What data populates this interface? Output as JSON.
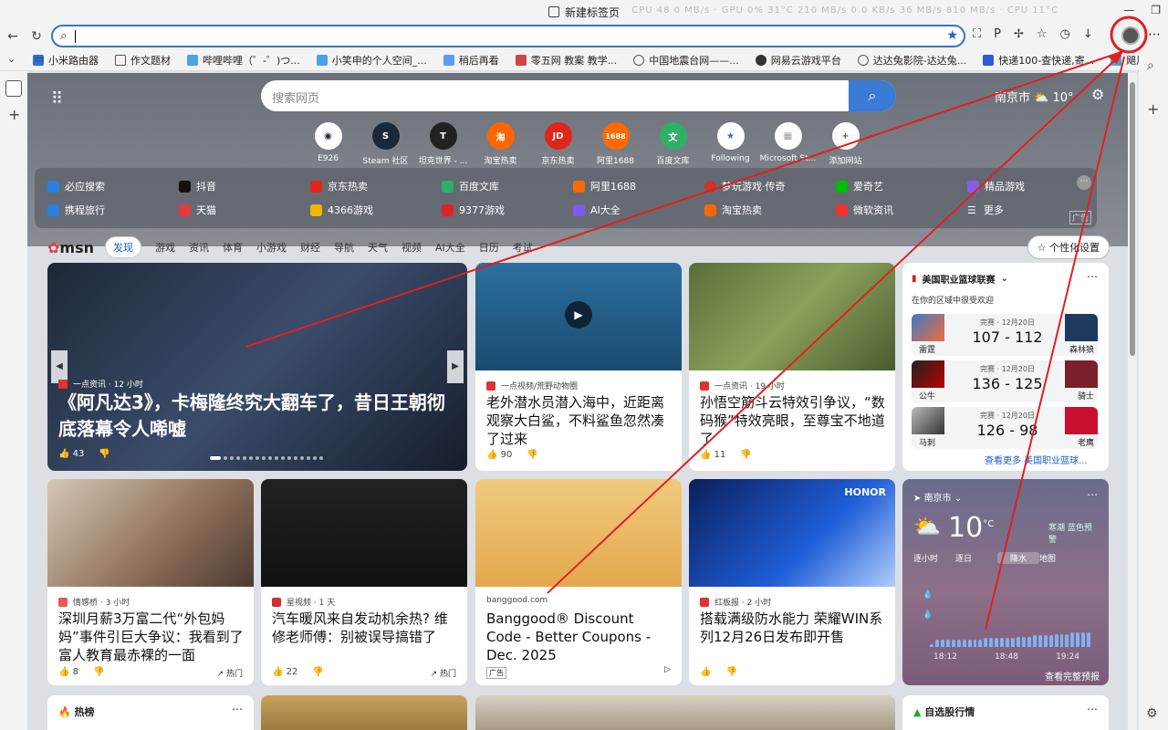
{
  "window": {
    "title": "新建标签页",
    "perf": "CPU 48 0 MB/s · GPU 0% 31°C 210 MB/s 0.0 KB/s 36 MB/s 810 MB/s · CPU 11°C"
  },
  "addressbar": {
    "value": ""
  },
  "bookmarks": [
    "小米路由器",
    "作文题材",
    "哔哩哔哩（゜-゜)つ...",
    "小笑申的个人空间_...",
    "稍后再看",
    "零五网 教案 教学...",
    "中国地震台网——...",
    "网易云游戏平台",
    "达达兔影院-达达兔...",
    "快递100-查快递,寄...",
    "飓风战魂_搜狗..."
  ],
  "ntp": {
    "search_placeholder": "搜索网页",
    "weather_city": "南京市",
    "weather_temp": "10°",
    "quick_links": [
      "E926",
      "Steam 社区",
      "坦克世界 - ...",
      "淘宝热卖",
      "京东热卖",
      "阿里1688",
      "百度文库",
      "Following",
      "Microsoft St...",
      "添加网站"
    ],
    "links_row1": [
      "必应搜索",
      "抖音",
      "京东热卖",
      "百度文库",
      "阿里1688",
      "梦玩游戏·传奇",
      "爱奇艺",
      "精品游戏"
    ],
    "links_row2": [
      "携程旅行",
      "天猫",
      "4366游戏",
      "9377游戏",
      "AI大全",
      "淘宝热卖",
      "微软资讯",
      "更多"
    ],
    "ad_label": "广告"
  },
  "msn": {
    "logo": "msn",
    "nav": [
      "发现",
      "游戏",
      "资讯",
      "体育",
      "小游戏",
      "财经",
      "导航",
      "天气",
      "视频",
      "AI大全",
      "日历",
      "考试"
    ],
    "personalize": "个性化设置"
  },
  "cards": {
    "hero": {
      "source": "一点资讯 · 12 小时",
      "title": "《阿凡达3》，卡梅隆终究大翻车了，昔日王朝彻底落幕令人唏嘘",
      "likes": "43"
    },
    "shark": {
      "source": "一点视频/荒野动物圈",
      "title": "老外潜水员潜入海中，近距离观察大白鲨，不料鲨鱼忽然凑了过来",
      "likes": "90"
    },
    "game": {
      "source": "一点资讯 · 19 小时",
      "title": "孙悟空筋斗云特效引争议，“数码猴”特效亮眼，至尊宝不地道了",
      "likes": "11"
    },
    "mom": {
      "source": "情感桥 · 3 小时",
      "title": "深圳月薪3万富二代“外包妈妈”事件引巨大争议：我看到了富人教育最赤裸的一面",
      "likes": "8",
      "hot": "热门"
    },
    "car": {
      "source": "星视频 · 1 天",
      "title": "汽车暖风来自发动机余热? 维修老师傅：别被误导搞错了",
      "likes": "22",
      "hot": "热门"
    },
    "ad": {
      "source": "banggood.com",
      "title": "Banggood® Discount Code - Better Coupons - Dec. 2025",
      "adtag": "广告"
    },
    "honor": {
      "source": "红板报 · 2 小时",
      "title": "搭载满级防水能力 荣耀WIN系列12月26日发布即开售",
      "brand": "HONOR"
    }
  },
  "nba": {
    "title": "美国职业篮球联赛",
    "subtitle": "在你的区域中很受欢迎",
    "games": [
      {
        "date": "完赛 · 12月20日",
        "left": "雷霆",
        "right": "森林狼",
        "score": "107 - 112"
      },
      {
        "date": "完赛 · 12月20日",
        "left": "公牛",
        "right": "骑士",
        "score": "136 - 125"
      },
      {
        "date": "完赛 · 12月20日",
        "left": "马刺",
        "right": "老鹰",
        "score": "126 - 98"
      }
    ],
    "more": "查看更多 美国职业篮球..."
  },
  "weather": {
    "city": "南京市",
    "temp": "10",
    "unit": "°C",
    "alert": "寒潮 蓝色预警",
    "tabs": [
      "逐小时",
      "逐日",
      "降水",
      "地图"
    ],
    "times": [
      "18:12",
      "18:48",
      "19:24"
    ],
    "more": "查看完整预报",
    "precip_levels": [
      0.2,
      0.5,
      0.5,
      0.5,
      0.5,
      0.5,
      0.5,
      0.5,
      0.5,
      0.5,
      0.6,
      0.6,
      0.6,
      0.6,
      0.6,
      0.6,
      0.7,
      0.7,
      0.7,
      0.8,
      0.8,
      0.8,
      0.8,
      0.9,
      0.9,
      0.9,
      1,
      1,
      1,
      1
    ]
  },
  "bottom": {
    "hot": "热榜",
    "stocks": "自选股行情"
  }
}
